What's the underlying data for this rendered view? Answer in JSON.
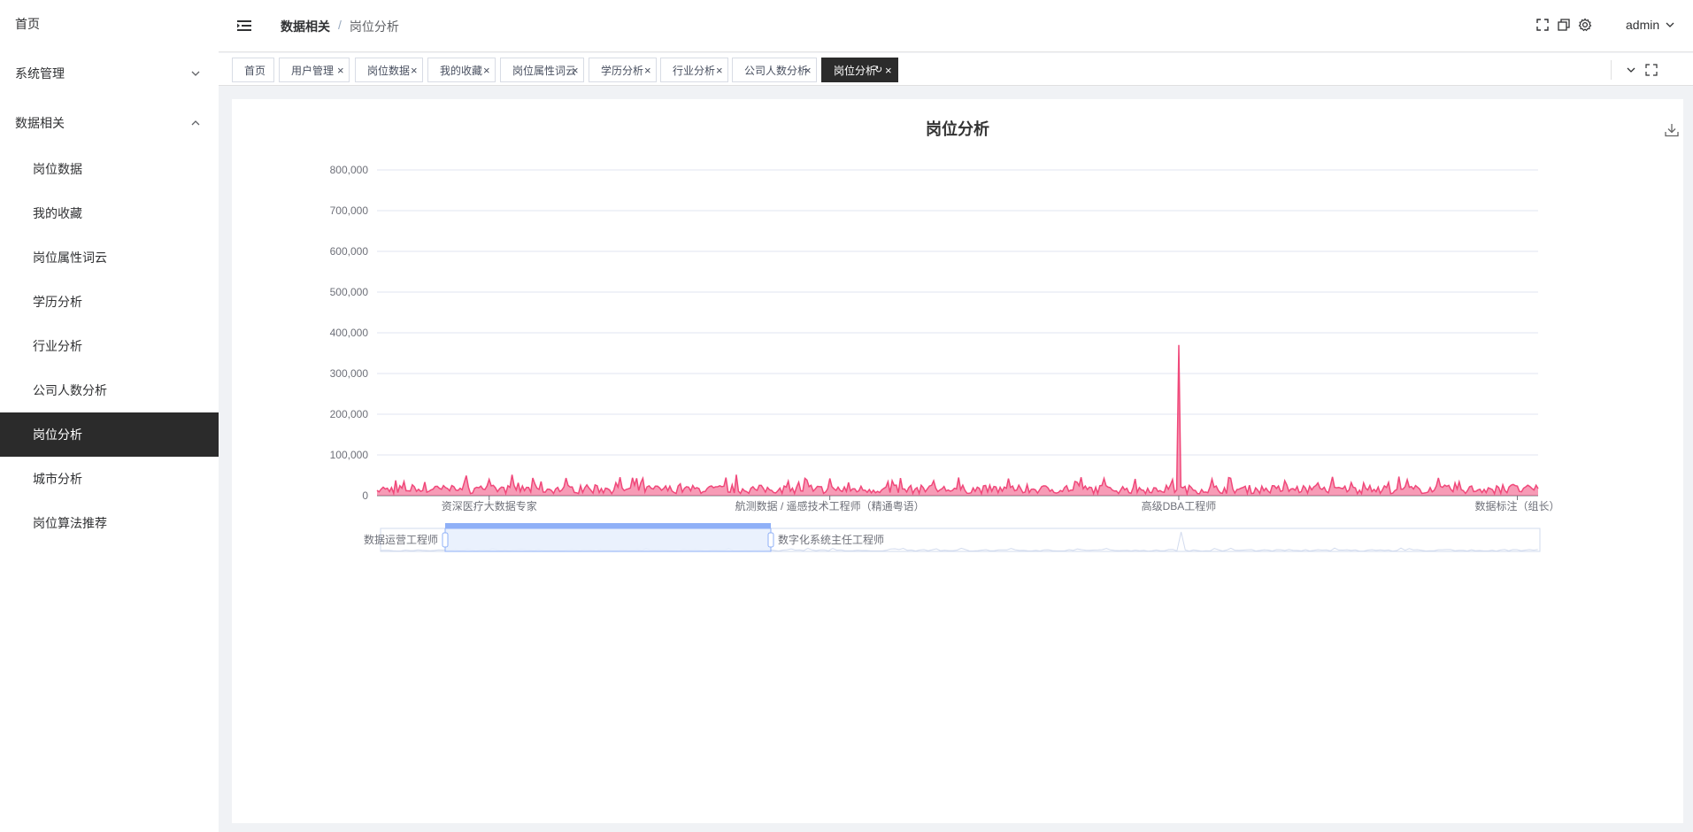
{
  "sidebar": {
    "home": "首页",
    "system": "系统管理",
    "data": "数据相关",
    "items": [
      "岗位数据",
      "我的收藏",
      "岗位属性词云",
      "学历分析",
      "行业分析",
      "公司人数分析",
      "岗位分析",
      "城市分析",
      "岗位算法推荐"
    ],
    "active_item": "岗位分析"
  },
  "header": {
    "breadcrumb_parent": "数据相关",
    "breadcrumb_sep": "/",
    "breadcrumb_current": "岗位分析",
    "user": "admin"
  },
  "tabs": [
    "首页",
    "用户管理",
    "岗位数据",
    "我的收藏",
    "岗位属性词云",
    "学历分析",
    "行业分析",
    "公司人数分析",
    "岗位分析"
  ],
  "active_tab": "岗位分析",
  "chart_data": {
    "type": "area",
    "title": "岗位分析",
    "xlabel": "",
    "ylabel": "",
    "ylim": [
      0,
      800000
    ],
    "ytick_labels": [
      "0",
      "100,000",
      "200,000",
      "300,000",
      "400,000",
      "500,000",
      "600,000",
      "700,000",
      "800,000"
    ],
    "x_tick_labels": [
      "资深医疗大数据专家",
      "航测数据 / 遥感技术工程师（精通粤语）",
      "高级DBA工程师",
      "数据标注（组长）"
    ],
    "peaks": [
      {
        "x": "高级DBA工程师",
        "y": 370000
      },
      {
        "x": "资深医疗大数据专家",
        "y": 40000
      }
    ],
    "typical_range": [
      5000,
      40000
    ],
    "color": "#f0487a",
    "grid": true,
    "datazoom": {
      "start_label": "数据运营工程师",
      "end_label": "数字化系统主任工程师"
    }
  },
  "colors": {
    "accent": "#f0487a",
    "sidebar_active": "#2b2b2b",
    "datazoom_fill": "#e6effd"
  }
}
